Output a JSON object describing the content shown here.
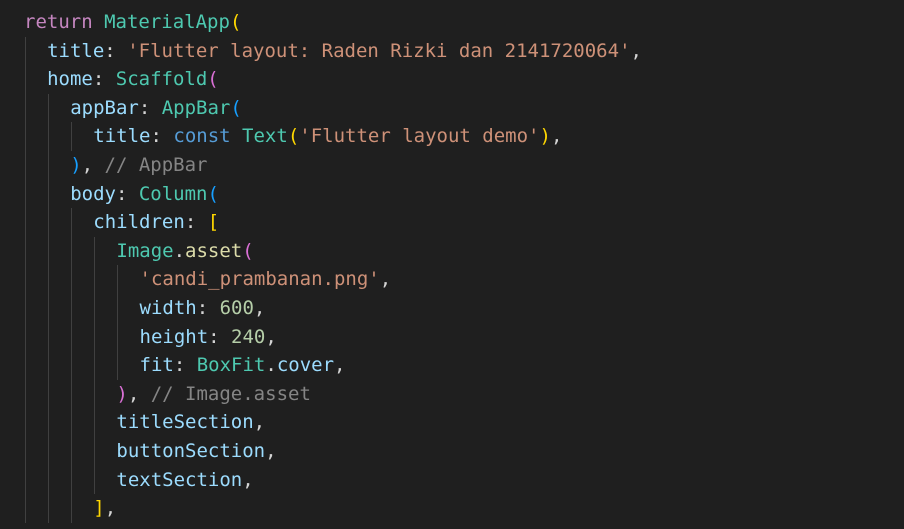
{
  "editor": {
    "language": "dart",
    "theme_colors": {
      "background": "#1f1f1f",
      "keyword": "#c586c0",
      "class": "#4ec9b0",
      "property": "#9cdcfe",
      "string": "#ce9178",
      "number": "#b5cea8",
      "function": "#dcdcaa",
      "constant": "#569cd6",
      "comment": "#858585",
      "punctuation": "#d4d4d4",
      "bracket_gold": "#ffd700",
      "bracket_pink": "#da70d6",
      "bracket_blue": "#179fff",
      "indent_guide": "#404040"
    },
    "lines": [
      [
        {
          "t": "return",
          "c": "kw"
        },
        {
          "t": " ",
          "c": "pun"
        },
        {
          "t": "MaterialApp",
          "c": "cls"
        },
        {
          "t": "(",
          "c": "gold"
        }
      ],
      [
        {
          "t": "title",
          "c": "prop"
        },
        {
          "t": ": ",
          "c": "pun"
        },
        {
          "t": "'Flutter layout: Raden Rizki dan 2141720064'",
          "c": "str"
        },
        {
          "t": ",",
          "c": "pun"
        }
      ],
      [
        {
          "t": "home",
          "c": "prop"
        },
        {
          "t": ": ",
          "c": "pun"
        },
        {
          "t": "Scaffold",
          "c": "cls"
        },
        {
          "t": "(",
          "c": "pink"
        }
      ],
      [
        {
          "t": "appBar",
          "c": "prop"
        },
        {
          "t": ": ",
          "c": "pun"
        },
        {
          "t": "AppBar",
          "c": "cls"
        },
        {
          "t": "(",
          "c": "blue"
        }
      ],
      [
        {
          "t": "title",
          "c": "prop"
        },
        {
          "t": ": ",
          "c": "pun"
        },
        {
          "t": "const",
          "c": "cnst"
        },
        {
          "t": " ",
          "c": "pun"
        },
        {
          "t": "Text",
          "c": "cls"
        },
        {
          "t": "(",
          "c": "gold"
        },
        {
          "t": "'Flutter layout demo'",
          "c": "str"
        },
        {
          "t": ")",
          "c": "gold"
        },
        {
          "t": ",",
          "c": "pun"
        }
      ],
      [
        {
          "t": ")",
          "c": "blue"
        },
        {
          "t": ", ",
          "c": "pun"
        },
        {
          "t": "// AppBar",
          "c": "com"
        }
      ],
      [
        {
          "t": "body",
          "c": "prop"
        },
        {
          "t": ": ",
          "c": "pun"
        },
        {
          "t": "Column",
          "c": "cls"
        },
        {
          "t": "(",
          "c": "blue"
        }
      ],
      [
        {
          "t": "children",
          "c": "prop"
        },
        {
          "t": ": ",
          "c": "pun"
        },
        {
          "t": "[",
          "c": "gold"
        }
      ],
      [
        {
          "t": "Image",
          "c": "cls"
        },
        {
          "t": ".",
          "c": "pun"
        },
        {
          "t": "asset",
          "c": "fn"
        },
        {
          "t": "(",
          "c": "pink"
        }
      ],
      [
        {
          "t": "'candi_prambanan.png'",
          "c": "str"
        },
        {
          "t": ",",
          "c": "pun"
        }
      ],
      [
        {
          "t": "width",
          "c": "prop"
        },
        {
          "t": ": ",
          "c": "pun"
        },
        {
          "t": "600",
          "c": "num"
        },
        {
          "t": ",",
          "c": "pun"
        }
      ],
      [
        {
          "t": "height",
          "c": "prop"
        },
        {
          "t": ": ",
          "c": "pun"
        },
        {
          "t": "240",
          "c": "num"
        },
        {
          "t": ",",
          "c": "pun"
        }
      ],
      [
        {
          "t": "fit",
          "c": "prop"
        },
        {
          "t": ": ",
          "c": "pun"
        },
        {
          "t": "BoxFit",
          "c": "cls"
        },
        {
          "t": ".",
          "c": "pun"
        },
        {
          "t": "cover",
          "c": "prop"
        },
        {
          "t": ",",
          "c": "pun"
        }
      ],
      [
        {
          "t": ")",
          "c": "pink"
        },
        {
          "t": ", ",
          "c": "pun"
        },
        {
          "t": "// Image.asset",
          "c": "com"
        }
      ],
      [
        {
          "t": "titleSection",
          "c": "prop"
        },
        {
          "t": ",",
          "c": "pun"
        }
      ],
      [
        {
          "t": "buttonSection",
          "c": "prop"
        },
        {
          "t": ",",
          "c": "pun"
        }
      ],
      [
        {
          "t": "textSection",
          "c": "prop"
        },
        {
          "t": ",",
          "c": "pun"
        }
      ],
      [
        {
          "t": "]",
          "c": "gold"
        },
        {
          "t": ",",
          "c": "pun"
        }
      ]
    ]
  }
}
